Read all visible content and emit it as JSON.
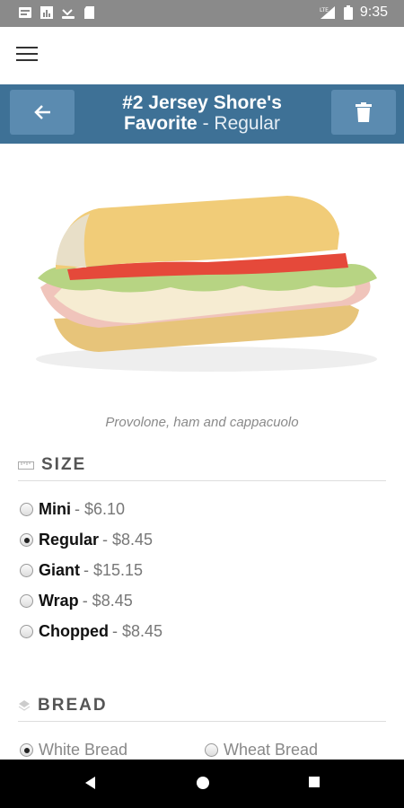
{
  "status_bar": {
    "time": "9:35"
  },
  "header": {
    "title": "#2 Jersey Shore's Favorite",
    "size_suffix": " - Regular"
  },
  "caption": "Provolone, ham and cappacuolo",
  "size_section": {
    "title": "SIZE",
    "options": [
      {
        "name": "Mini",
        "price": "- $6.10",
        "checked": false
      },
      {
        "name": "Regular",
        "price": "- $8.45",
        "checked": true
      },
      {
        "name": "Giant",
        "price": "- $15.15",
        "checked": false
      },
      {
        "name": "Wrap",
        "price": "- $8.45",
        "checked": false
      },
      {
        "name": "Chopped",
        "price": "- $8.45",
        "checked": false
      }
    ]
  },
  "bread_section": {
    "title": "BREAD",
    "options": [
      {
        "name": "White Bread",
        "checked": true
      },
      {
        "name": "Wheat Bread",
        "checked": false
      }
    ]
  },
  "colors": {
    "header": "#3e7196",
    "header_button": "#5b8bb0",
    "status_bar": "#8a8a8a"
  }
}
